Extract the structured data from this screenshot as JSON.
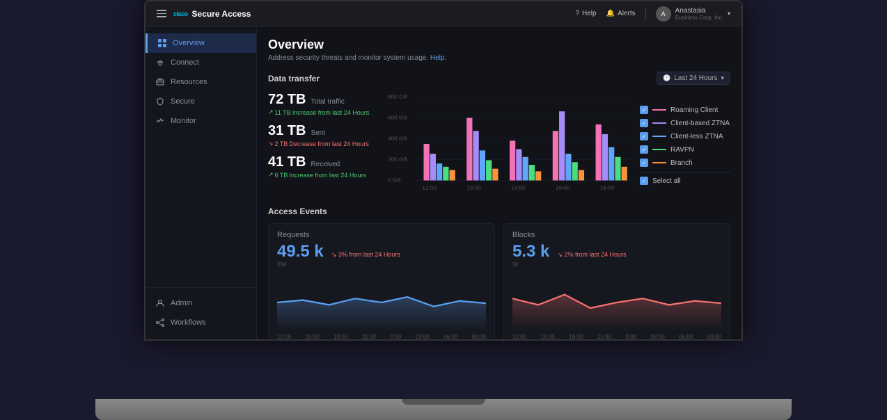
{
  "topbar": {
    "brand_name": "Secure Access",
    "help_label": "Help",
    "alerts_label": "Alerts",
    "user_name": "Anastasia",
    "user_company": "Business Corp, Inc.",
    "bell_icon": "🔔",
    "question_icon": "?"
  },
  "sidebar": {
    "items": [
      {
        "id": "overview",
        "label": "Overview",
        "active": true
      },
      {
        "id": "connect",
        "label": "Connect",
        "active": false
      },
      {
        "id": "resources",
        "label": "Resources",
        "active": false
      },
      {
        "id": "secure",
        "label": "Secure",
        "active": false
      },
      {
        "id": "monitor",
        "label": "Monitor",
        "active": false
      }
    ],
    "bottom_items": [
      {
        "id": "admin",
        "label": "Admin"
      },
      {
        "id": "workflows",
        "label": "Workflows"
      }
    ]
  },
  "page": {
    "title": "Overview",
    "subtitle": "Address security threats and monitor system usage.",
    "subtitle_link": "Help."
  },
  "data_transfer": {
    "section_title": "Data transfer",
    "time_filter": "Last 24 Hours",
    "total_traffic_value": "72 TB",
    "total_traffic_label": "Total traffic",
    "total_traffic_change": "11 TB",
    "total_traffic_change_direction": "up",
    "total_traffic_change_text": "Increase from last 24 Hours",
    "sent_value": "31 TB",
    "sent_label": "Sent",
    "sent_change": "2 TB",
    "sent_change_direction": "down",
    "sent_change_text": "Decrease from last 24 Hours",
    "received_value": "41 TB",
    "received_label": "Received",
    "received_change": "6 TB",
    "received_change_direction": "up",
    "received_change_text": "Increase from last 24 Hours",
    "y_axis_labels": [
      "800 GB",
      "600 GB",
      "400 GB",
      "200 GB",
      "0 GB"
    ],
    "x_axis_labels": [
      "12:00",
      "13:00",
      "14:00",
      "15:00",
      "16:00"
    ],
    "legend": [
      {
        "label": "Roaming Client",
        "color": "#f472b6"
      },
      {
        "label": "Client-based ZTNA",
        "color": "#a78bfa"
      },
      {
        "label": "Client-less ZTNA",
        "color": "#60a5fa"
      },
      {
        "label": "RAVPN",
        "color": "#4ade80"
      },
      {
        "label": "Branch",
        "color": "#fb923c"
      },
      {
        "label": "Select all",
        "color": "#5b9ef0"
      }
    ]
  },
  "access_events": {
    "section_title": "Access Events",
    "requests": {
      "title": "Requests",
      "value": "49.5 k",
      "change": "3%",
      "change_direction": "down",
      "change_text": "from last 24 Hours",
      "y_label": "25K",
      "time_labels": [
        "12:00",
        "15:00",
        "18:00",
        "21:00",
        "0:00",
        "03:00",
        "06:00",
        "09:00"
      ]
    },
    "blocks": {
      "title": "Blocks",
      "value": "5.3 k",
      "change": "2%",
      "change_direction": "down",
      "change_text": "from last 24 Hours",
      "y_label": "3k",
      "time_labels": [
        "12:00",
        "15:00",
        "18:00",
        "21:00",
        "0:00",
        "03:00",
        "06:00",
        "09:00"
      ]
    }
  }
}
